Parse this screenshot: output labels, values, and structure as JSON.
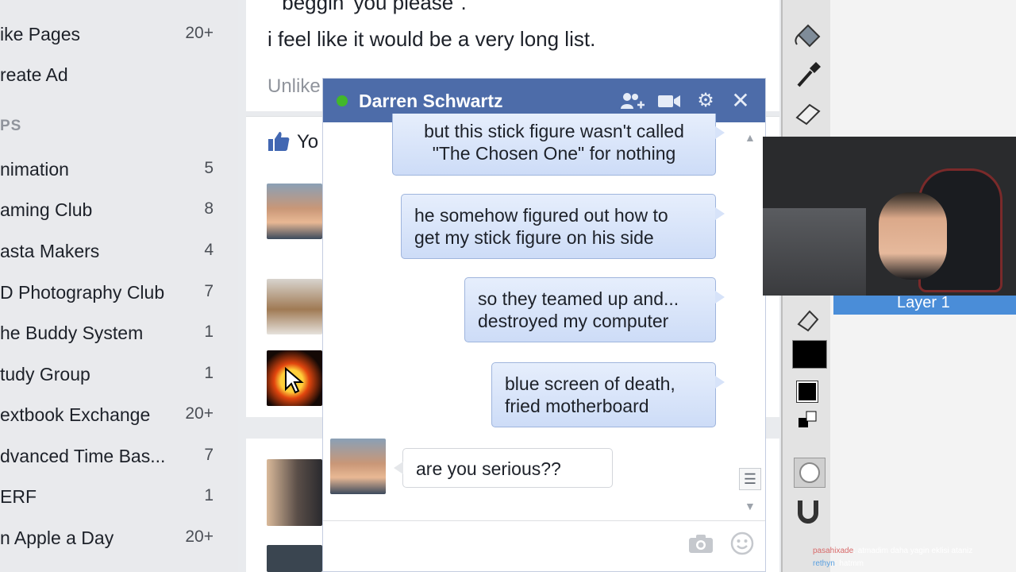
{
  "sidebar": {
    "top_items": [
      {
        "label": "ike Pages",
        "count": "20+"
      },
      {
        "label": "reate Ad",
        "count": ""
      }
    ],
    "section_header": "PS",
    "groups": [
      {
        "label": "nimation",
        "count": "5"
      },
      {
        "label": "aming Club",
        "count": "8"
      },
      {
        "label": "asta Makers",
        "count": "4"
      },
      {
        "label": "D Photography Club",
        "count": "7"
      },
      {
        "label": "he Buddy System",
        "count": "1"
      },
      {
        "label": "tudy Group",
        "count": "1"
      },
      {
        "label": "extbook Exchange",
        "count": "20+"
      },
      {
        "label": "dvanced Time Bas...",
        "count": "7"
      },
      {
        "label": "ERF",
        "count": "1"
      },
      {
        "label": "n Apple a Day",
        "count": "20+"
      }
    ]
  },
  "feed": {
    "post_text_1": "\"beggin' you please\".",
    "post_text_2": "i feel like it would be a very long list.",
    "unlike_label": "Unlike",
    "like_you_label": "Yo"
  },
  "chat": {
    "contact_name": "Darren Schwartz",
    "messages": [
      {
        "line1": "but this stick figure wasn't called",
        "line2": "\"The Chosen One\" for nothing"
      },
      {
        "line1": "he somehow figured out how to",
        "line2": "get my stick figure on his side"
      },
      {
        "line1": "so they teamed up and...",
        "line2": "destroyed my computer"
      },
      {
        "line1": "blue screen of death,",
        "line2": "fried motherboard"
      }
    ],
    "incoming": "are you serious??"
  },
  "app": {
    "layer_label": "Layer 1"
  },
  "stream_chat": {
    "msg1_user": "pasahixade",
    "msg1_text": ": atmadim daha yagin eklisi ataniz",
    "msg2_user": "rethyn",
    "msg2_text": ": hatmm"
  },
  "colors": {
    "chat_header": "#4d6ca9",
    "online_dot": "#42b72a",
    "bubble_out": "#d7e3f9"
  }
}
